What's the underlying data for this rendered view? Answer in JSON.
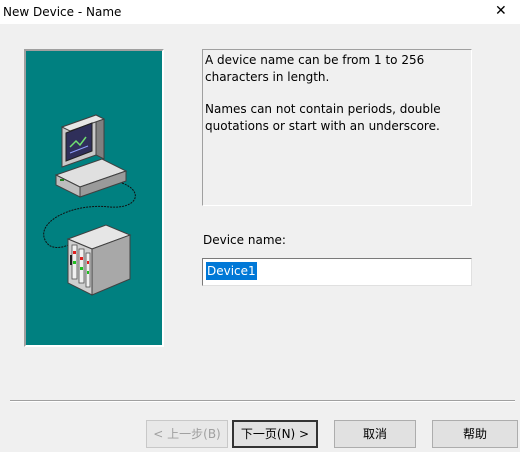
{
  "window": {
    "title": "New Device - Name",
    "close_glyph": "✕"
  },
  "illustration": {
    "icons": [
      "computer-icon",
      "plc-device-icon"
    ],
    "background_color": "#008080"
  },
  "info": {
    "line1": "A device name can be from 1 to 256 characters in length.",
    "line2": "Names can not contain periods, double quotations or start with an underscore."
  },
  "device_name": {
    "label": "Device name:",
    "value": "Device1"
  },
  "buttons": {
    "back": "< 上一步(B)",
    "next": "下一页(N) >",
    "cancel": "取消",
    "help": "帮助"
  }
}
